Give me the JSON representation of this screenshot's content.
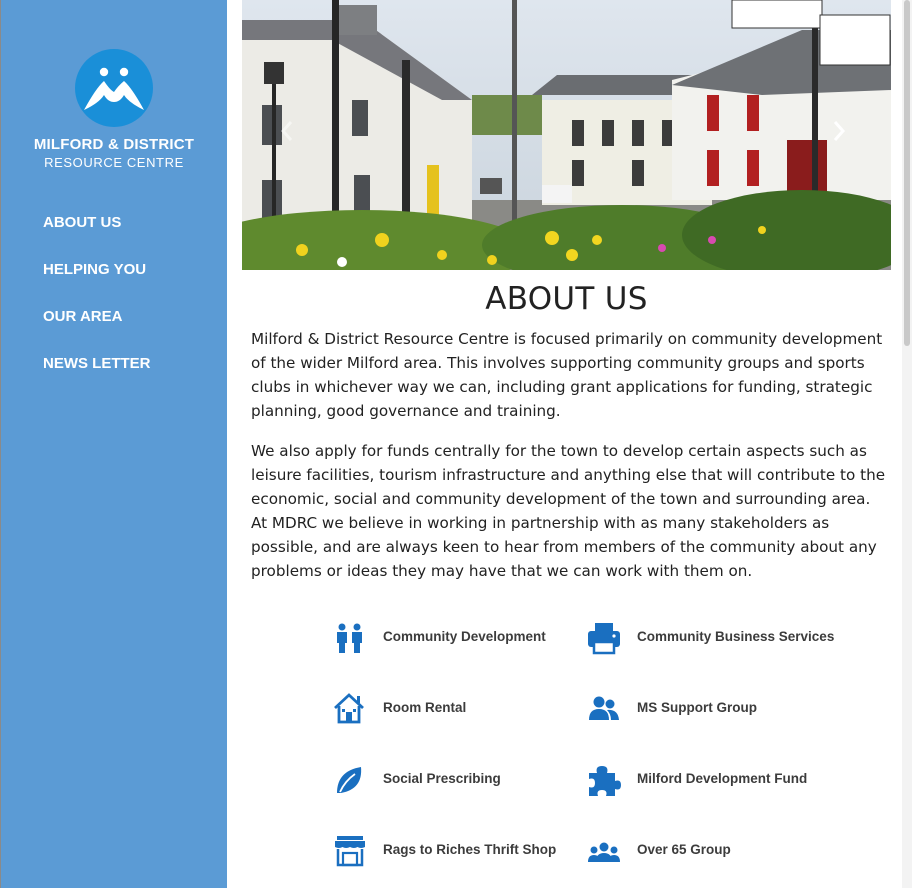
{
  "brand": {
    "line1": "MILFORD & DISTRICT",
    "line2": "RESOURCE CENTRE"
  },
  "nav": {
    "items": [
      {
        "label": "ABOUT US"
      },
      {
        "label": "HELPING YOU"
      },
      {
        "label": "OUR AREA"
      },
      {
        "label": "NEWS LETTER"
      }
    ]
  },
  "hero": {
    "prev_icon": "chevron-left-icon",
    "next_icon": "chevron-right-icon"
  },
  "main": {
    "title": "ABOUT US",
    "paragraph1": "Milford & District Resource Centre is focused primarily on community development of the wider Milford area. This involves supporting community groups and sports clubs in whichever way we can, including grant applications for funding, strategic planning, good governance and training.",
    "paragraph2": "We also apply for funds centrally for the town to develop certain aspects such as leisure facilities, tourism infrastructure and anything else that will contribute to the economic, social and community development of the town and surrounding area. At MDRC we believe in working in partnership with as many stakeholders as possible, and are always keen to hear from members of the community about any problems or ideas they may have that we can work with them on."
  },
  "services": [
    {
      "label": "Community Development",
      "icon": "people-icon"
    },
    {
      "label": "Community Business Services",
      "icon": "printer-icon"
    },
    {
      "label": "Room Rental",
      "icon": "house-icon"
    },
    {
      "label": "MS Support Group",
      "icon": "user-group-icon"
    },
    {
      "label": "Social Prescribing",
      "icon": "leaf-icon"
    },
    {
      "label": "Milford Development Fund",
      "icon": "puzzle-icon"
    },
    {
      "label": "Rags to Riches Thrift Shop",
      "icon": "store-icon"
    },
    {
      "label": "Over 65 Group",
      "icon": "group-icon"
    }
  ],
  "colors": {
    "sidebar": "#5b9bd5",
    "icon_blue": "#1a6fc0",
    "logo_blue": "#1a8fd8"
  }
}
